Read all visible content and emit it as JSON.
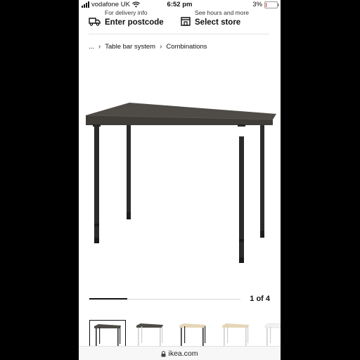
{
  "status_bar": {
    "carrier": "vodafone UK",
    "time": "6:52 pm",
    "battery_percent": "3%",
    "battery_level": 0.03,
    "battery_color": "#e02020"
  },
  "header": {
    "delivery": {
      "sub": "For delivery info",
      "main": "Enter postcode",
      "icon": "truck-icon"
    },
    "store": {
      "sub": "See hours and more",
      "main": "Select store",
      "icon": "store-icon"
    }
  },
  "breadcrumb": {
    "ellipsis": "...",
    "items": [
      "Table bar system",
      "Combinations"
    ]
  },
  "product_image": {
    "description_icon": "desk-image",
    "top_color": "#4f4c47",
    "leg_color": "#2b2b2b"
  },
  "carousel": {
    "counter": "1 of 4",
    "progress": 0.25
  },
  "thumbnails": [
    {
      "top": "#4f4c47",
      "legs": "#2b2b2b",
      "selected": true
    },
    {
      "top": "#4f4c47",
      "legs": "#f2f2f2",
      "selected": false
    },
    {
      "top": "#e5d6b8",
      "legs": "#2b2b2b",
      "selected": false
    },
    {
      "top": "#e5d6b8",
      "legs": "#f2f2f2",
      "selected": false
    },
    {
      "top": "#f2f2f2",
      "legs": "#f2f2f2",
      "selected": false
    }
  ],
  "url_bar": {
    "domain": "ikea.com",
    "icon": "lock-icon"
  }
}
